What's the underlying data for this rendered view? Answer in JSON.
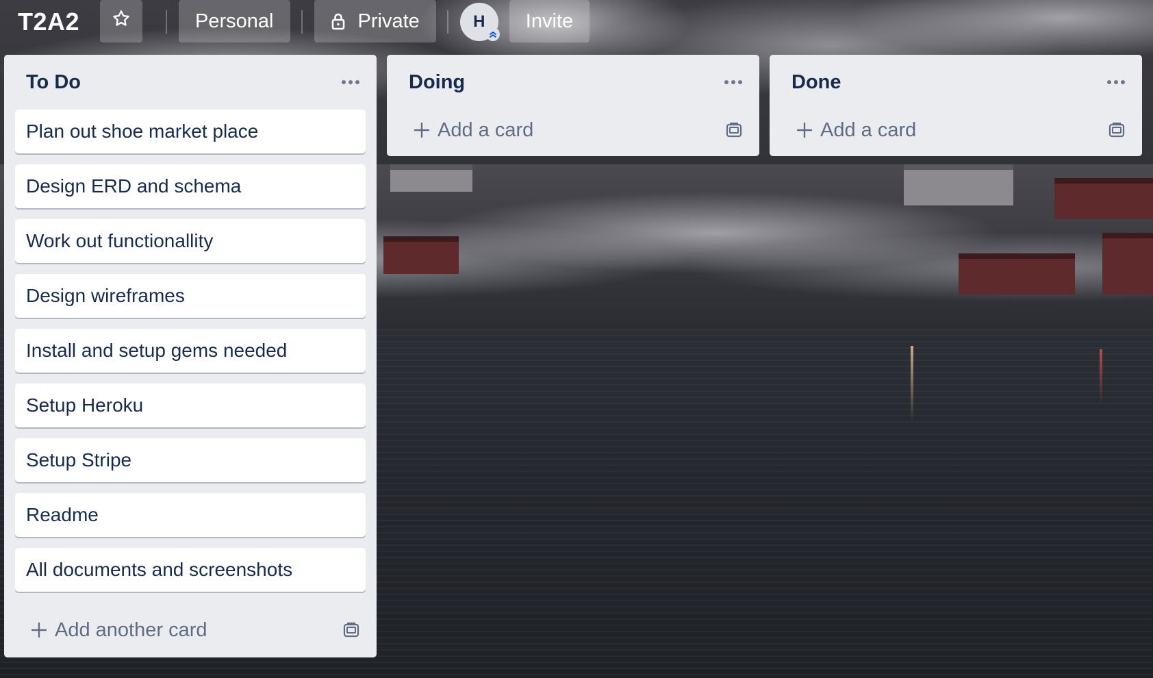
{
  "header": {
    "board_title": "T2A2",
    "star_icon": "star-icon",
    "visibility_team": "Personal",
    "visibility_privacy": "Private",
    "lock_icon": "lock-icon",
    "member_avatar_initial": "H",
    "invite_label": "Invite"
  },
  "lists": [
    {
      "title": "To Do",
      "cards": [
        "Plan out shoe market place",
        "Design ERD and schema",
        "Work out functionallity",
        "Design wireframes",
        "Install and setup gems needed",
        "Setup Heroku",
        "Setup Stripe",
        "Readme",
        "All documents and screenshots"
      ],
      "composer_label": "Add another card"
    },
    {
      "title": "Doing",
      "cards": [],
      "composer_label": "Add a card"
    },
    {
      "title": "Done",
      "cards": [],
      "composer_label": "Add a card"
    }
  ],
  "colors": {
    "list_bg": "#ebecf0",
    "card_bg": "#ffffff",
    "text_primary": "#172b4d",
    "text_muted": "#5e6c84"
  }
}
